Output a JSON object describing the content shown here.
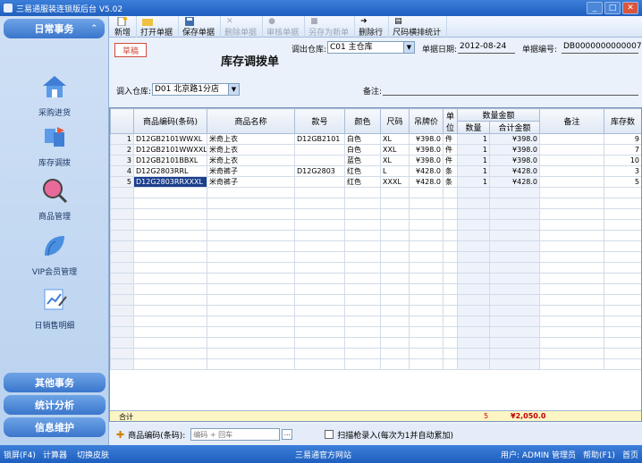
{
  "app_title": "三易通服装连锁版后台 V5.02",
  "sidebar": {
    "top_tab": "日常事务",
    "items": [
      {
        "label": "采购进货",
        "icon": "house-icon"
      },
      {
        "label": "库存调拨",
        "icon": "transfer-icon"
      },
      {
        "label": "商品管理",
        "icon": "magnifier-icon"
      },
      {
        "label": "VIP会员管理",
        "icon": "leaf-icon"
      },
      {
        "label": "日销售明细",
        "icon": "chart-icon"
      }
    ],
    "bottom_tabs": [
      "其他事务",
      "统计分析",
      "信息维护"
    ]
  },
  "toolbar": {
    "new": "新增",
    "open": "打开单据",
    "save": "保存单据",
    "delete": "删除单据",
    "audit": "审核单据",
    "save_as": "另存为新单",
    "delete_row": "删除行",
    "size_stats": "尺码横排统计"
  },
  "form": {
    "draft": "草稿",
    "title": "库存调拨单",
    "out_wh_label": "调出仓库:",
    "out_wh_value": "C01 主仓库",
    "date_label": "单据日期:",
    "date_value": "2012-08-24",
    "no_label": "单据编号:",
    "no_value": "DB0000000000007",
    "in_wh_label": "调入仓库:",
    "in_wh_value": "D01 北京路1分店",
    "remark_label": "备注:"
  },
  "grid": {
    "headers": [
      "商品编码(条码)",
      "商品名称",
      "款号",
      "颜色",
      "尺码",
      "吊牌价",
      "单位",
      "数量金额",
      "数量",
      "合计金额",
      "备注",
      "库存数"
    ],
    "rows": [
      {
        "n": "1",
        "code": "D12GB2101WWXL",
        "name": "米奇上衣",
        "style": "D12GB2101",
        "color": "白色",
        "size": "XL",
        "price": "¥398.0",
        "unit": "件",
        "qty": "1",
        "amount": "¥398.0",
        "note": "",
        "stock": "9"
      },
      {
        "n": "2",
        "code": "D12GB2101WWXXL",
        "name": "米奇上衣",
        "style": "",
        "color": "白色",
        "size": "XXL",
        "price": "¥398.0",
        "unit": "件",
        "qty": "1",
        "amount": "¥398.0",
        "note": "",
        "stock": "7"
      },
      {
        "n": "3",
        "code": "D12GB2101BBXL",
        "name": "米奇上衣",
        "style": "",
        "color": "蓝色",
        "size": "XL",
        "price": "¥398.0",
        "unit": "件",
        "qty": "1",
        "amount": "¥398.0",
        "note": "",
        "stock": "10"
      },
      {
        "n": "4",
        "code": "D12G2803RRL",
        "name": "米奇裤子",
        "style": "D12G2803",
        "color": "红色",
        "size": "L",
        "price": "¥428.0",
        "unit": "条",
        "qty": "1",
        "amount": "¥428.0",
        "note": "",
        "stock": "3"
      },
      {
        "n": "5",
        "code": "D12G2803RRXXXL",
        "name": "米奇裤子",
        "style": "",
        "color": "红色",
        "size": "XXXL",
        "price": "¥428.0",
        "unit": "条",
        "qty": "1",
        "amount": "¥428.0",
        "note": "",
        "stock": "5"
      }
    ],
    "total_label": "合计",
    "total_qty": "5",
    "total_amount": "¥2,050.0"
  },
  "bottom": {
    "code_label": "商品编码(条码):",
    "code_placeholder": "编码 + 回车",
    "scan_label": "扫描枪录入(每次为1并自动累加)"
  },
  "status": {
    "lock": "锁屏(F4)",
    "calc": "计算器",
    "skin": "切换皮肤",
    "site": "三易通官方网站",
    "user": "用户: ADMIN 管理员",
    "help": "帮助(F1)",
    "home": "首页"
  }
}
